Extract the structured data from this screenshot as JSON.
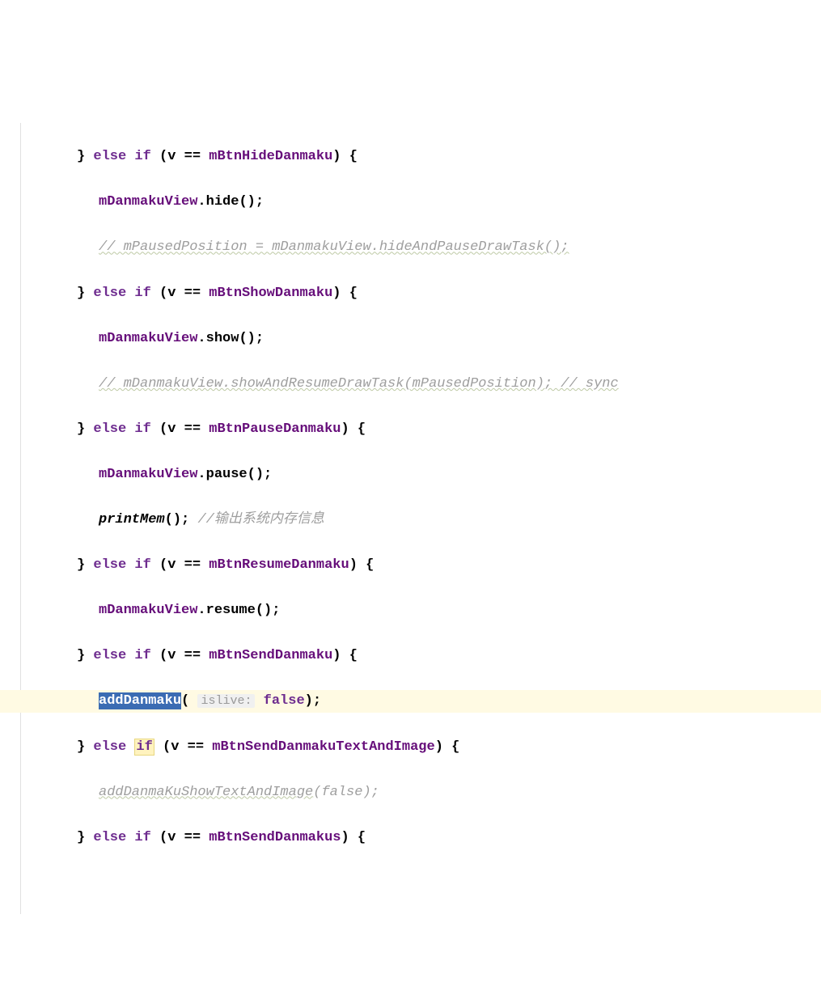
{
  "code": {
    "kw_else": "else",
    "kw_if": "if",
    "kw_false": "false",
    "var_v": "v",
    "op_eq": "==",
    "field_mBtnHideDanmaku": "mBtnHideDanmaku",
    "field_mBtnShowDanmaku": "mBtnShowDanmaku",
    "field_mBtnPauseDanmaku": "mBtnPauseDanmaku",
    "field_mBtnResumeDanmaku": "mBtnResumeDanmaku",
    "field_mBtnSendDanmaku": "mBtnSendDanmaku",
    "field_mBtnSendDanmakuTextAndImage": "mBtnSendDanmakuTextAndImage",
    "field_mBtnSendDanmakus": "mBtnSendDanmakus",
    "field_mDanmakuView": "mDanmakuView",
    "method_hide": "hide",
    "method_show": "show",
    "method_pause": "pause",
    "method_resume": "resume",
    "method_addDanmaku": "addDanmaku",
    "method_printMem": "printMem",
    "method_addDanmaKuShowTextAndImage": "addDanmaKuShowTextAndImage",
    "comment_hideAndPause": "// mPausedPosition = mDanmakuView.hideAndPauseDrawTask();",
    "comment_showAndResume": "// mDanmakuView.showAndResumeDrawTask(mPausedPosition); // sync",
    "comment_printMem": "//输出系统内存信息",
    "param_islive": "islive:",
    "arg_false_italic": "false",
    "brace_open": "{",
    "brace_close": "}",
    "paren_open": "(",
    "paren_close": ")",
    "semicolon": ";",
    "dot": "."
  }
}
